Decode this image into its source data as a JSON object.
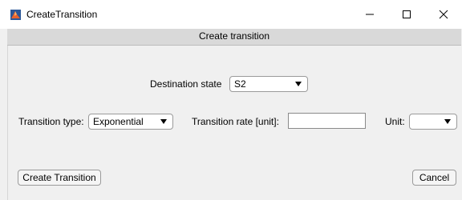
{
  "window": {
    "title": "CreateTransition",
    "controls": {
      "minimize_icon": "minimize-icon",
      "maximize_icon": "maximize-icon",
      "close_icon": "close-icon"
    }
  },
  "panel": {
    "title": "Create transition"
  },
  "form": {
    "destination_state": {
      "label": "Destination state",
      "selected": "S2"
    },
    "transition_type": {
      "label": "Transition type:",
      "selected": "Exponential"
    },
    "transition_rate": {
      "label": "Transition rate [unit]:",
      "value": ""
    },
    "unit": {
      "label": "Unit:",
      "selected": ""
    }
  },
  "buttons": {
    "create_label": "Create Transition",
    "cancel_label": "Cancel"
  },
  "colors": {
    "window_bg": "#f0f0f0",
    "panel_header_bg": "#d9d9d9",
    "icon_orange": "#e8622c",
    "icon_blue": "#2b5797"
  }
}
